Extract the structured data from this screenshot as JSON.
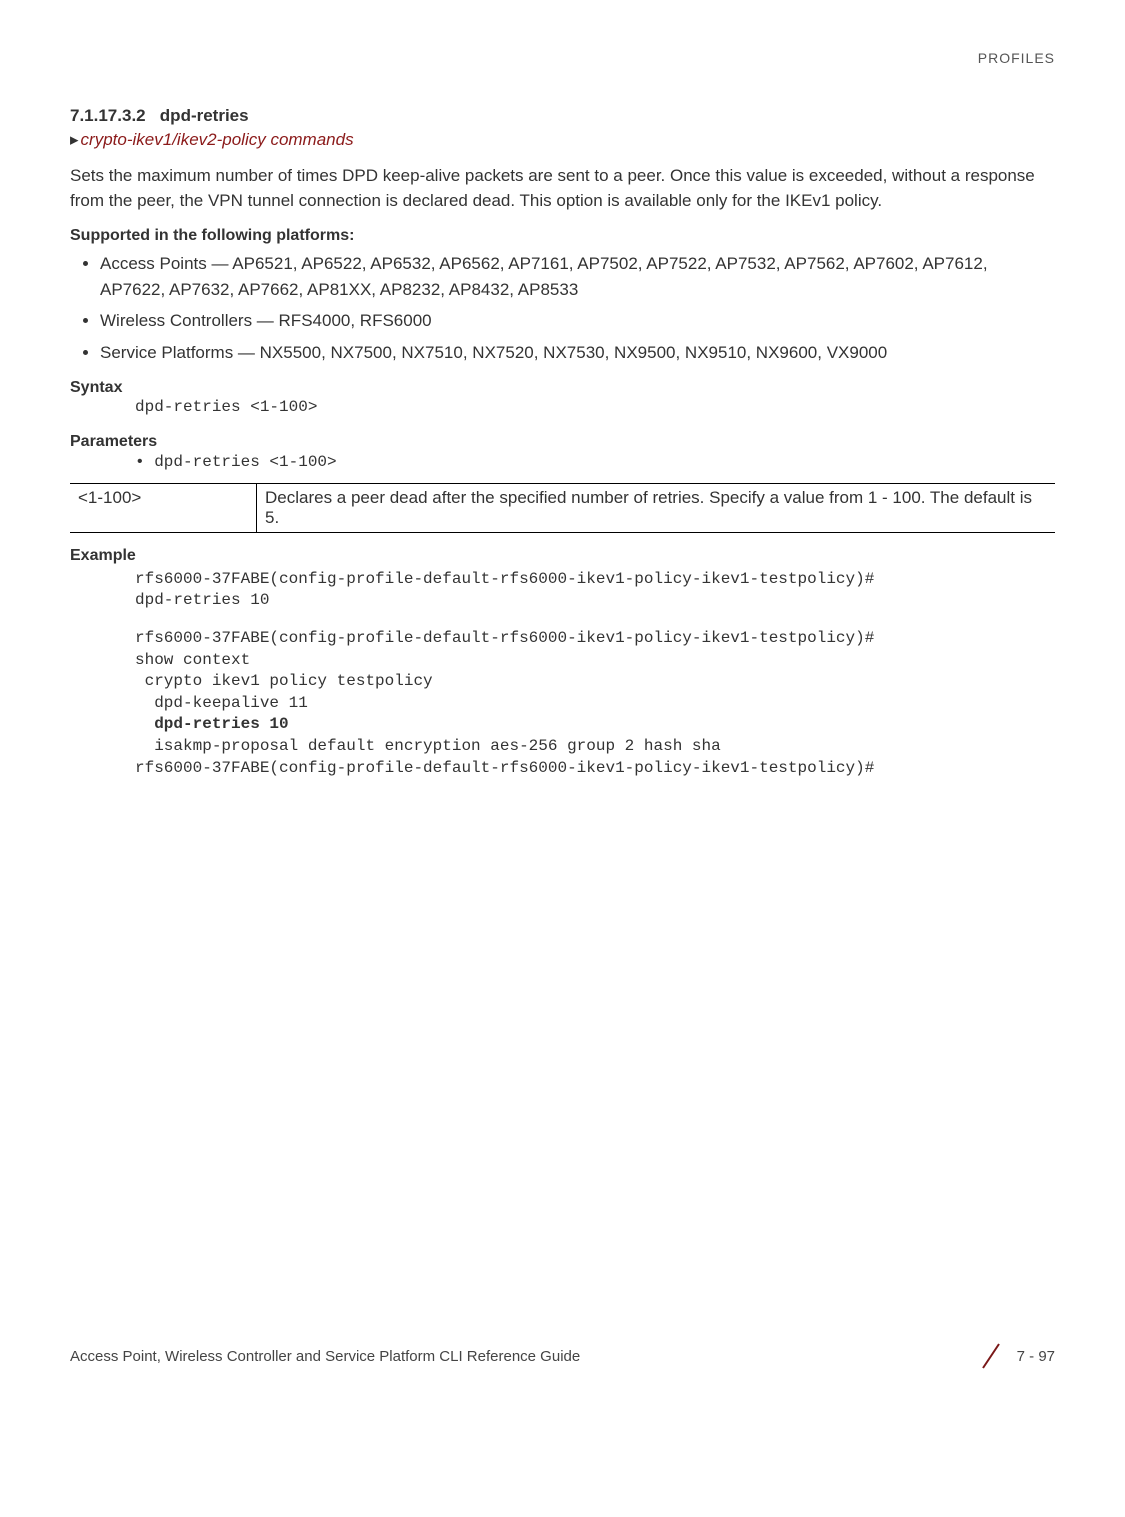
{
  "header": {
    "category": "PROFILES"
  },
  "section": {
    "number": "7.1.17.3.2",
    "title": "dpd-retries"
  },
  "breadcrumb": "crypto-ikev1/ikev2-policy commands",
  "intro": "Sets the maximum number of times DPD keep-alive packets are sent to a peer. Once this value is exceeded, without a response from the peer, the VPN tunnel connection is declared dead. This option is available only for the IKEv1 policy.",
  "supported_label": "Supported in the following platforms:",
  "platforms": [
    "Access Points — AP6521, AP6522, AP6532, AP6562, AP7161, AP7502, AP7522, AP7532, AP7562, AP7602, AP7612, AP7622, AP7632, AP7662, AP81XX, AP8232, AP8432, AP8533",
    "Wireless Controllers — RFS4000, RFS6000",
    "Service Platforms — NX5500, NX7500, NX7510, NX7520, NX7530, NX9500, NX9510, NX9600, VX9000"
  ],
  "syntax_label": "Syntax",
  "syntax_text": "dpd-retries <1-100>",
  "parameters_label": "Parameters",
  "parameters_bullet": "• dpd-retries <1-100>",
  "param_table": {
    "key": "<1-100>",
    "desc": "Declares a peer dead after the specified number of retries. Specify a value from 1 - 100. The default is 5."
  },
  "example_label": "Example",
  "example_lines_a": "rfs6000-37FABE(config-profile-default-rfs6000-ikev1-policy-ikev1-testpolicy)#\ndpd-retries 10",
  "example_lines_b": "rfs6000-37FABE(config-profile-default-rfs6000-ikev1-policy-ikev1-testpolicy)#\nshow context\n crypto ikev1 policy testpolicy\n  dpd-keepalive 11",
  "example_bold": "  dpd-retries 10",
  "example_lines_c": "  isakmp-proposal default encryption aes-256 group 2 hash sha\nrfs6000-37FABE(config-profile-default-rfs6000-ikev1-policy-ikev1-testpolicy)#",
  "footer": {
    "left": "Access Point, Wireless Controller and Service Platform CLI Reference Guide",
    "right": "7 - 97"
  }
}
